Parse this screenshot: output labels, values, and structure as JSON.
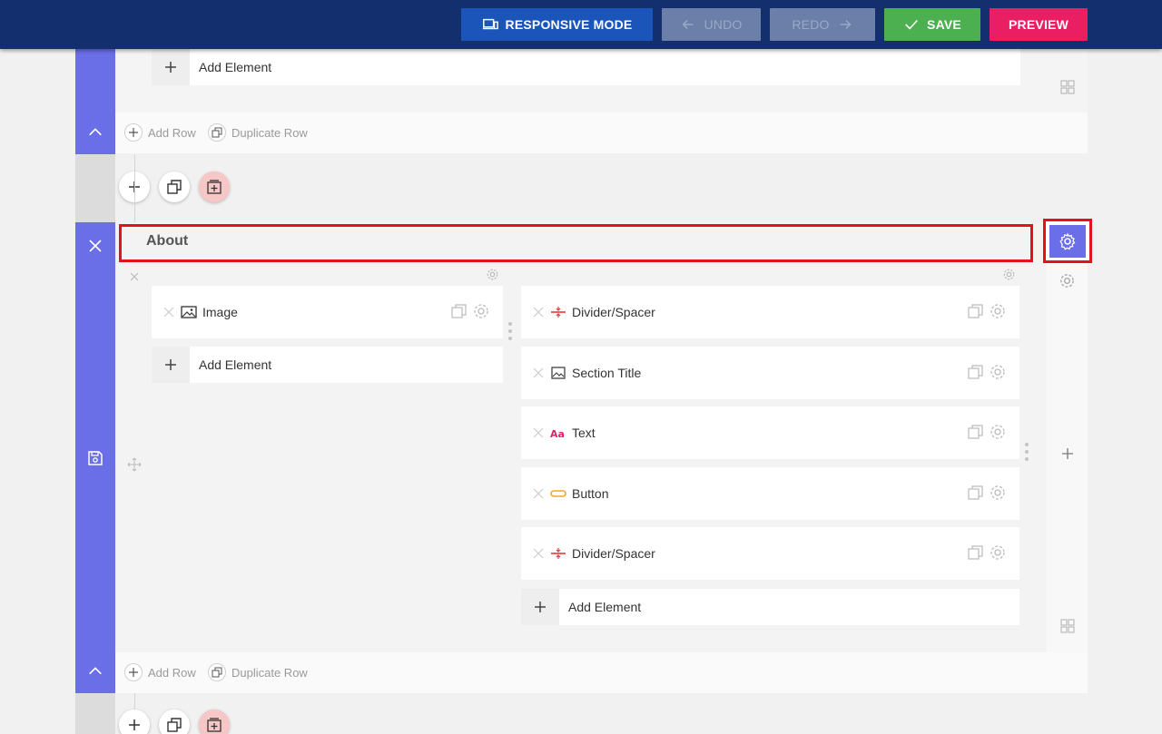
{
  "toolbar": {
    "responsive_label": "RESPONSIVE MODE",
    "undo_label": "UNDO",
    "redo_label": "REDO",
    "save_label": "SAVE",
    "preview_label": "PREVIEW"
  },
  "row_actions": {
    "add_row": "Add Row",
    "duplicate_row": "Duplicate Row"
  },
  "add_element_label": "Add Element",
  "section": {
    "title": "About"
  },
  "left_column": {
    "elements": [
      {
        "label": "Image",
        "icon": "image-icon"
      }
    ]
  },
  "right_column": {
    "elements": [
      {
        "label": "Divider/Spacer",
        "icon": "divider-icon"
      },
      {
        "label": "Section Title",
        "icon": "section-title-icon"
      },
      {
        "label": "Text",
        "icon": "text-icon"
      },
      {
        "label": "Button",
        "icon": "button-icon"
      },
      {
        "label": "Divider/Spacer",
        "icon": "divider-icon"
      }
    ]
  },
  "colors": {
    "topbar": "#132f6e",
    "accent_purple": "#6a6ee7",
    "save_green": "#4caf50",
    "preview_pink": "#e91e63",
    "highlight_red": "#e3131b"
  }
}
